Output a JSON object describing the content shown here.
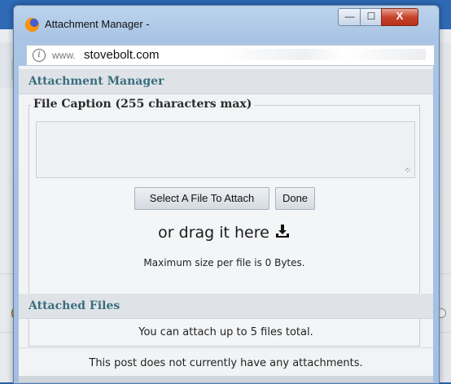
{
  "window": {
    "title": "Attachment Manager -",
    "buttons": {
      "minimize": "—",
      "maximize": "☐",
      "close": "X"
    }
  },
  "address_bar": {
    "scheme": "www.",
    "host": "stovebolt.com"
  },
  "attachment_manager": {
    "header": "Attachment Manager",
    "caption_legend": "File Caption (255 characters max)",
    "caption_value": "",
    "select_button": "Select A File To Attach",
    "done_button": "Done",
    "drag_text": "or drag it here",
    "max_size_text": "Maximum size per file is 0 Bytes."
  },
  "attached_files": {
    "header": "Attached Files",
    "limit_text": "You can attach up to 5 files total.",
    "none_text": "This post does not currently have any attachments."
  },
  "icons": {
    "browser": "firefox-icon",
    "info": "info-icon",
    "drag": "download-icon"
  },
  "colors": {
    "section_header_text": "#3a6e7e",
    "window_frame": "#a9c4e4",
    "close_button": "#c8432b"
  }
}
